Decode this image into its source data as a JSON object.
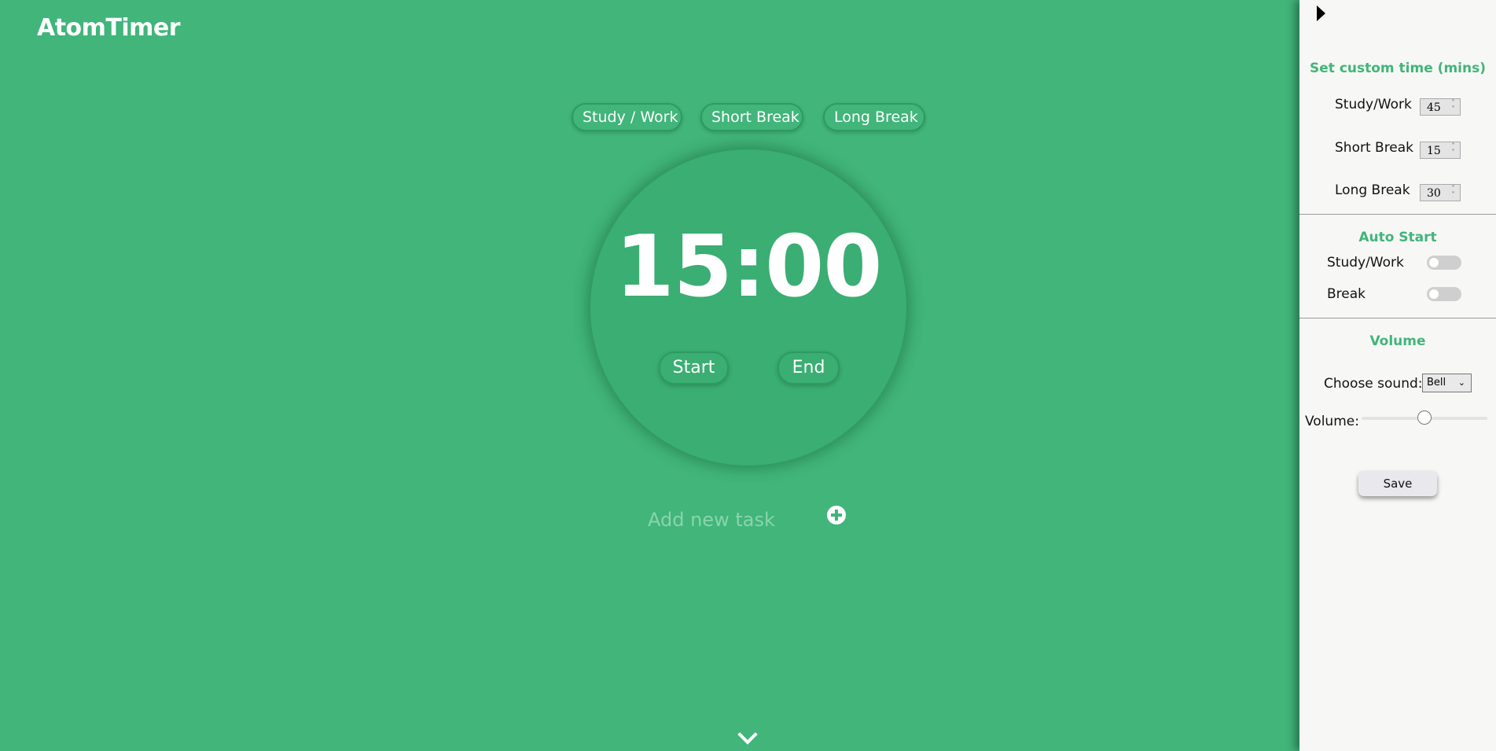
{
  "app": {
    "title": "AtomTimer"
  },
  "colors": {
    "background": "#41b57a",
    "accent": "#41b57a",
    "panel": "#f7f7f5"
  },
  "modes": {
    "study": "Study / Work",
    "short_break": "Short Break",
    "long_break": "Long Break"
  },
  "timer": {
    "display": "15:00",
    "start_label": "Start",
    "end_label": "End"
  },
  "task": {
    "placeholder": "Add new task",
    "add_icon": "plus-circle-icon"
  },
  "footer": {
    "scroll_icon": "chevron-down-icon"
  },
  "settings": {
    "collapse_icon": "caret-right-icon",
    "custom_time": {
      "title": "Set custom time (mins)",
      "study_label": "Study/Work",
      "study_value": "45",
      "short_label": "Short Break",
      "short_value": "15",
      "long_label": "Long Break",
      "long_value": "30"
    },
    "auto_start": {
      "title": "Auto Start",
      "study_label": "Study/Work",
      "study_on": false,
      "break_label": "Break",
      "break_on": false
    },
    "volume": {
      "title": "Volume",
      "sound_label": "Choose sound:",
      "sound_value": "Bell",
      "volume_label": "Volume:",
      "volume_level": 0.5
    },
    "save_label": "Save"
  }
}
